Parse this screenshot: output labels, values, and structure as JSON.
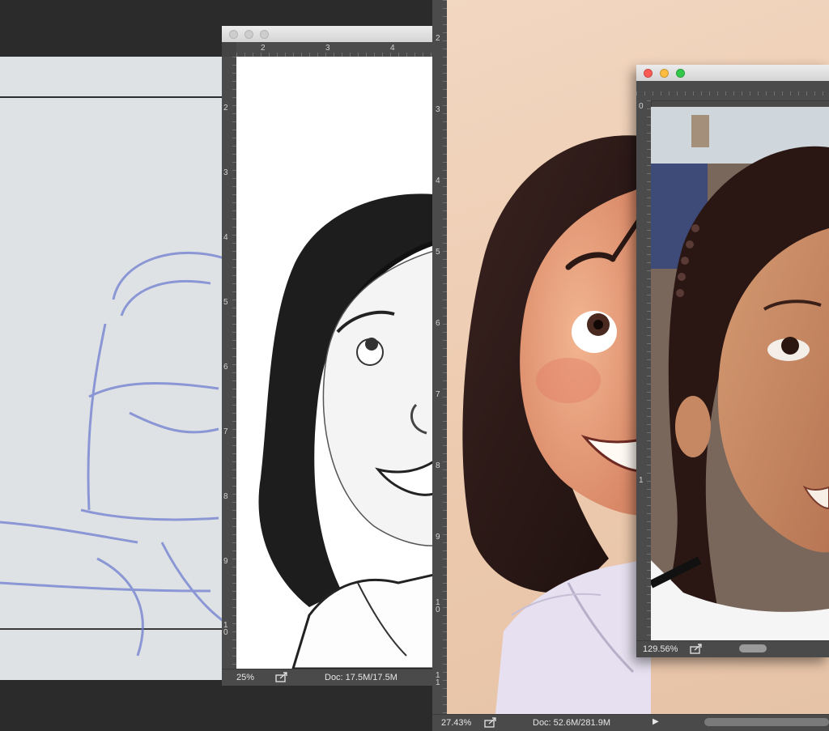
{
  "sketch_window": {
    "ruler_h": [
      "2",
      "3",
      "4"
    ],
    "ruler_v": [
      "2",
      "3",
      "4",
      "5",
      "6",
      "7",
      "8",
      "9",
      "1\n0"
    ],
    "zoom": "25%",
    "doc_size": "Doc: 17.5M/17.5M"
  },
  "paint_window": {
    "ruler_v": [
      "2",
      "3",
      "4",
      "5",
      "6",
      "7",
      "8",
      "9",
      "1\n0",
      "1\n1"
    ],
    "zoom": "27.43%",
    "doc_size": "Doc: 52.6M/281.9M"
  },
  "photo_window": {
    "ruler_v": [
      "0",
      "1"
    ],
    "zoom": "129.56%"
  },
  "colors": {
    "close": "#fc5c54",
    "minimize": "#fdbc40",
    "zoom": "#34c84a",
    "inactive_light": "#cdcdcd",
    "workspace": "#2b2b2b",
    "panel": "#4a4a4a"
  }
}
